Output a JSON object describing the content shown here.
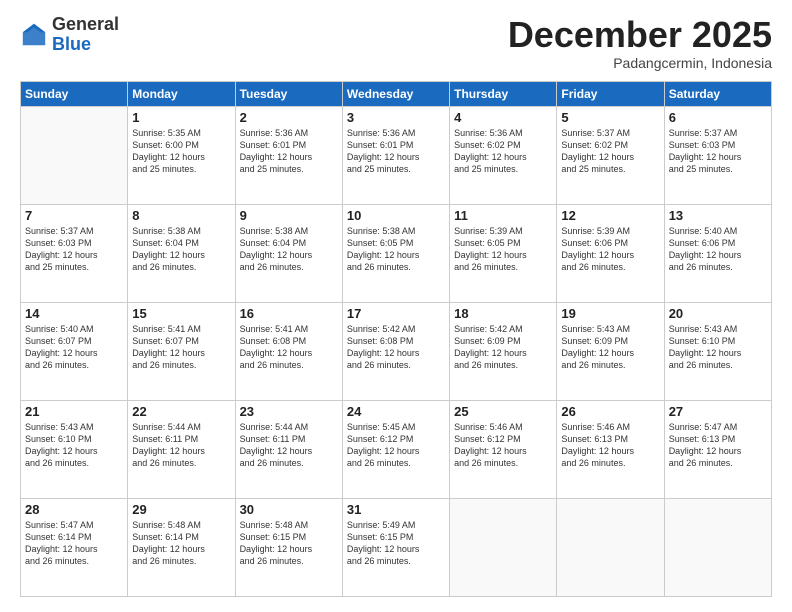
{
  "header": {
    "logo_general": "General",
    "logo_blue": "Blue",
    "month": "December 2025",
    "location": "Padangcermin, Indonesia"
  },
  "weekdays": [
    "Sunday",
    "Monday",
    "Tuesday",
    "Wednesday",
    "Thursday",
    "Friday",
    "Saturday"
  ],
  "weeks": [
    [
      {
        "day": "",
        "info": ""
      },
      {
        "day": "1",
        "info": "Sunrise: 5:35 AM\nSunset: 6:00 PM\nDaylight: 12 hours\nand 25 minutes."
      },
      {
        "day": "2",
        "info": "Sunrise: 5:36 AM\nSunset: 6:01 PM\nDaylight: 12 hours\nand 25 minutes."
      },
      {
        "day": "3",
        "info": "Sunrise: 5:36 AM\nSunset: 6:01 PM\nDaylight: 12 hours\nand 25 minutes."
      },
      {
        "day": "4",
        "info": "Sunrise: 5:36 AM\nSunset: 6:02 PM\nDaylight: 12 hours\nand 25 minutes."
      },
      {
        "day": "5",
        "info": "Sunrise: 5:37 AM\nSunset: 6:02 PM\nDaylight: 12 hours\nand 25 minutes."
      },
      {
        "day": "6",
        "info": "Sunrise: 5:37 AM\nSunset: 6:03 PM\nDaylight: 12 hours\nand 25 minutes."
      }
    ],
    [
      {
        "day": "7",
        "info": "Sunrise: 5:37 AM\nSunset: 6:03 PM\nDaylight: 12 hours\nand 25 minutes."
      },
      {
        "day": "8",
        "info": "Sunrise: 5:38 AM\nSunset: 6:04 PM\nDaylight: 12 hours\nand 26 minutes."
      },
      {
        "day": "9",
        "info": "Sunrise: 5:38 AM\nSunset: 6:04 PM\nDaylight: 12 hours\nand 26 minutes."
      },
      {
        "day": "10",
        "info": "Sunrise: 5:38 AM\nSunset: 6:05 PM\nDaylight: 12 hours\nand 26 minutes."
      },
      {
        "day": "11",
        "info": "Sunrise: 5:39 AM\nSunset: 6:05 PM\nDaylight: 12 hours\nand 26 minutes."
      },
      {
        "day": "12",
        "info": "Sunrise: 5:39 AM\nSunset: 6:06 PM\nDaylight: 12 hours\nand 26 minutes."
      },
      {
        "day": "13",
        "info": "Sunrise: 5:40 AM\nSunset: 6:06 PM\nDaylight: 12 hours\nand 26 minutes."
      }
    ],
    [
      {
        "day": "14",
        "info": "Sunrise: 5:40 AM\nSunset: 6:07 PM\nDaylight: 12 hours\nand 26 minutes."
      },
      {
        "day": "15",
        "info": "Sunrise: 5:41 AM\nSunset: 6:07 PM\nDaylight: 12 hours\nand 26 minutes."
      },
      {
        "day": "16",
        "info": "Sunrise: 5:41 AM\nSunset: 6:08 PM\nDaylight: 12 hours\nand 26 minutes."
      },
      {
        "day": "17",
        "info": "Sunrise: 5:42 AM\nSunset: 6:08 PM\nDaylight: 12 hours\nand 26 minutes."
      },
      {
        "day": "18",
        "info": "Sunrise: 5:42 AM\nSunset: 6:09 PM\nDaylight: 12 hours\nand 26 minutes."
      },
      {
        "day": "19",
        "info": "Sunrise: 5:43 AM\nSunset: 6:09 PM\nDaylight: 12 hours\nand 26 minutes."
      },
      {
        "day": "20",
        "info": "Sunrise: 5:43 AM\nSunset: 6:10 PM\nDaylight: 12 hours\nand 26 minutes."
      }
    ],
    [
      {
        "day": "21",
        "info": "Sunrise: 5:43 AM\nSunset: 6:10 PM\nDaylight: 12 hours\nand 26 minutes."
      },
      {
        "day": "22",
        "info": "Sunrise: 5:44 AM\nSunset: 6:11 PM\nDaylight: 12 hours\nand 26 minutes."
      },
      {
        "day": "23",
        "info": "Sunrise: 5:44 AM\nSunset: 6:11 PM\nDaylight: 12 hours\nand 26 minutes."
      },
      {
        "day": "24",
        "info": "Sunrise: 5:45 AM\nSunset: 6:12 PM\nDaylight: 12 hours\nand 26 minutes."
      },
      {
        "day": "25",
        "info": "Sunrise: 5:46 AM\nSunset: 6:12 PM\nDaylight: 12 hours\nand 26 minutes."
      },
      {
        "day": "26",
        "info": "Sunrise: 5:46 AM\nSunset: 6:13 PM\nDaylight: 12 hours\nand 26 minutes."
      },
      {
        "day": "27",
        "info": "Sunrise: 5:47 AM\nSunset: 6:13 PM\nDaylight: 12 hours\nand 26 minutes."
      }
    ],
    [
      {
        "day": "28",
        "info": "Sunrise: 5:47 AM\nSunset: 6:14 PM\nDaylight: 12 hours\nand 26 minutes."
      },
      {
        "day": "29",
        "info": "Sunrise: 5:48 AM\nSunset: 6:14 PM\nDaylight: 12 hours\nand 26 minutes."
      },
      {
        "day": "30",
        "info": "Sunrise: 5:48 AM\nSunset: 6:15 PM\nDaylight: 12 hours\nand 26 minutes."
      },
      {
        "day": "31",
        "info": "Sunrise: 5:49 AM\nSunset: 6:15 PM\nDaylight: 12 hours\nand 26 minutes."
      },
      {
        "day": "",
        "info": ""
      },
      {
        "day": "",
        "info": ""
      },
      {
        "day": "",
        "info": ""
      }
    ]
  ]
}
